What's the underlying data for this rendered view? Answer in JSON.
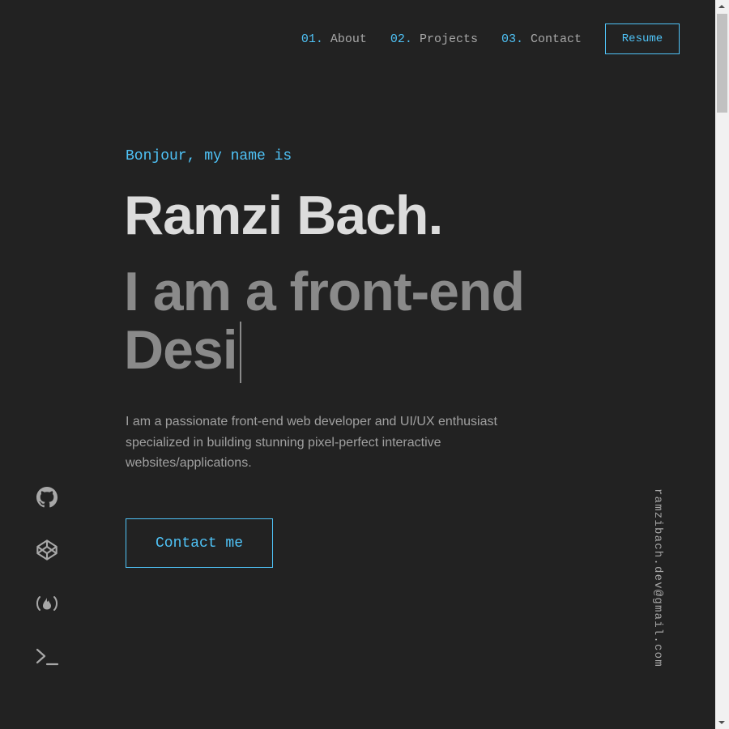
{
  "nav": {
    "items": [
      {
        "num": "01.",
        "label": "About"
      },
      {
        "num": "02.",
        "label": "Projects"
      },
      {
        "num": "03.",
        "label": "Contact"
      }
    ],
    "resume_label": "Resume"
  },
  "hero": {
    "greeting": "Bonjour, my name is",
    "name": "Ramzi Bach.",
    "tagline_line1": "I am a front-end",
    "tagline_line2": "Desi",
    "bio": "I am a passionate front-end web developer and UI/UX enthusiast specialized in building stunning pixel-perfect interactive websites/applications.",
    "contact_label": "Contact me"
  },
  "social": {
    "icons": [
      "github-icon",
      "codepen-icon",
      "freecodecamp-icon",
      "terminal-icon"
    ]
  },
  "email": "ramzibach.dev@gmail.com",
  "colors": {
    "background": "#222222",
    "accent": "#4fc3f7",
    "name_text": "#dcdcdc",
    "tagline_text": "#8a8a8a",
    "body_text": "#a0a0a0",
    "muted_text": "#a8a8a8"
  }
}
